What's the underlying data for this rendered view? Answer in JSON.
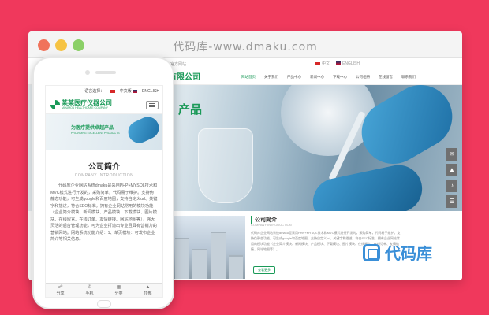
{
  "browser": {
    "title": "代码库-www.dmaku.com"
  },
  "desktop": {
    "topline_text": "欢迎光临某某医疗仪器有限公司官方网站",
    "lang_cn": "中文",
    "lang_en": "ENGLISH",
    "logo": "某某医疗仪器有限公司",
    "menu": [
      "网站首页",
      "关于我们",
      "产品中心",
      "新闻中心",
      "下载中心",
      "公司相册",
      "在线留言",
      "联系我们"
    ],
    "hero_text": "产品",
    "about": {
      "heading": "公司简介",
      "subheading": "COMPANY INTRODUCTION",
      "paragraph": "代码库企业网站系统dmaku是采用PHP+MYSQL技术和MVC模式进行开发的，采购简单，代码易于维护。支持伪静态功能，可生成google和百度地图，支持自定义url、关键字和描述，符合SEO标准。拥有企业网站常用的模块功能（企业简介模块、新闻模块、产品模块、下载模块、图片模块、在线留言、在线订单、友情链接、网站地图等）。",
      "more": "查看更多"
    },
    "side_tools": [
      "✉",
      "▲",
      "♪",
      "☰"
    ]
  },
  "watermark": "代码库",
  "mobile": {
    "lang_label": "语言选择：",
    "lang_cn": "中文版",
    "lang_en": "ENGLISH",
    "logo_cn": "某某医疗仪器公司",
    "logo_en": "MOUMOU HEALTHCARE COMPANY",
    "banner_title": "为医疗提供卓越产品",
    "banner_sub": "PROVIDING EXCELLENT PRODUCTS",
    "section_title": "公司简介",
    "section_subtitle": "COMPANY INTRODUCTION",
    "paragraph": "代码库企业网站系统dmaku是采用PHP+MYSQL技术和MVC模式进行开发的，采购简单，代码易于维护。支持伪静态功能，可生成google和百度地图，支持自定义url、关键字和描述，符合SEO标准。拥有企业网站常用的模块功能（企业简介模块、新闻模块、产品模块、下载模块、图片模块、在线留言、在线订单、友情链接、网站地图等），强大灵活的后台管理功能，可为企业打造出专业且具有营销力的营销网站。网站系统功能介绍：1、单页模块：可发布企业简介等相关信息。",
    "footer": [
      {
        "icon": "share-icon",
        "glyph": "☍",
        "label": "分享"
      },
      {
        "icon": "phone-icon",
        "glyph": "✆",
        "label": "手机"
      },
      {
        "icon": "category-icon",
        "glyph": "▦",
        "label": "分类"
      },
      {
        "icon": "top-icon",
        "glyph": "▲",
        "label": "顶部"
      }
    ]
  }
}
